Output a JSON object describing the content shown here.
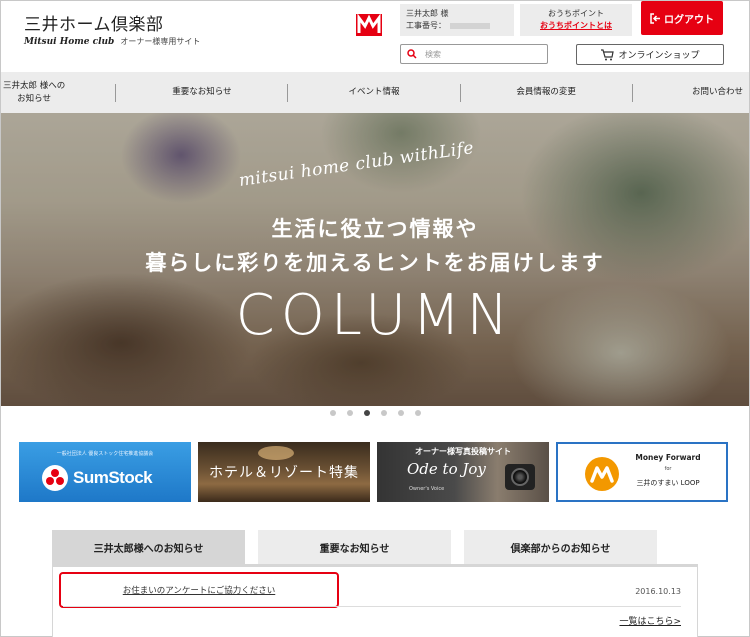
{
  "header": {
    "logo_title": "三井ホーム倶楽部",
    "logo_script": "Mitsui Home club",
    "logo_tagline": "オーナー様専用サイト",
    "user_name": "三井太郎 様",
    "user_number_label": "工事番号：",
    "points_title": "おうちポイント",
    "points_link": "おうちポイントとは",
    "logout_label": "ログアウト",
    "search_placeholder": "検索",
    "shop_label": "オンラインショップ"
  },
  "nav": {
    "items": [
      {
        "label_line1": "三井太郎 様への",
        "label_line2": "お知らせ"
      },
      {
        "label": "重要なお知らせ"
      },
      {
        "label": "イベント情報"
      },
      {
        "label": "会員情報の変更"
      },
      {
        "label": "お問い合わせ"
      }
    ]
  },
  "hero": {
    "script": "mitsui home club withLife",
    "line1": "生活に役立つ情報や",
    "line2": "暮らしに彩りを加えるヒントをお届けします",
    "column": "COLUMN",
    "slide_count": 6,
    "active_slide": 3
  },
  "banners": [
    {
      "tagline": "一般社団法人 優良ストック住宅推進協議会",
      "text": "SumStock"
    },
    {
      "text": "ホテル＆リゾート特集"
    },
    {
      "title": "オーナー様写真投稿サイト",
      "script": "Ode to Joy",
      "sub": "Owner's Voice"
    },
    {
      "brand": "Money Forward",
      "for": "for",
      "product": "三井のすまい LOOP"
    }
  ],
  "notices": {
    "tabs": [
      "三井太郎様へのお知らせ",
      "重要なお知らせ",
      "倶楽部からのお知らせ"
    ],
    "active_tab": 0,
    "items": [
      {
        "title": "お住まいのアンケートにご協力ください",
        "date": "2016.10.13"
      }
    ],
    "more_link": "一覧はこちら>"
  },
  "colors": {
    "accent_red": "#e60012",
    "nav_bg": "#ececec",
    "tab_active": "#d6d6d6",
    "banner_border_blue": "#2a73c4"
  }
}
